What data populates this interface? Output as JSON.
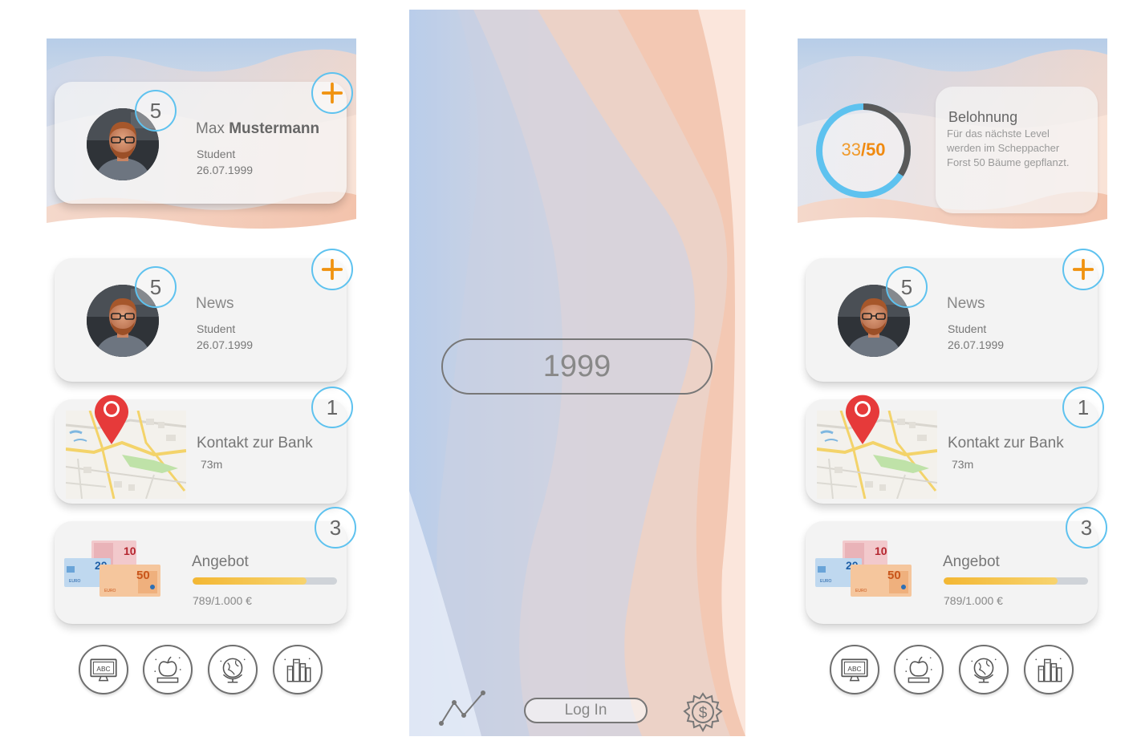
{
  "profile": {
    "first_name": "Max",
    "last_name": "Mustermann",
    "role": "Student",
    "birthdate": "26.07.1999",
    "badge_count": "5"
  },
  "news": {
    "title": "News",
    "role": "Student",
    "date": "26.07.1999",
    "badge_count": "5"
  },
  "bank": {
    "title": "Kontakt zur Bank",
    "distance": "73m",
    "badge_count": "1"
  },
  "offer": {
    "title": "Angebot",
    "amount_text": "789/1.000 €",
    "progress_current": 789,
    "progress_total": 1000,
    "badge_count": "3",
    "banknotes": [
      "10",
      "20",
      "50"
    ]
  },
  "login": {
    "year_value": "1999",
    "login_label": "Log In"
  },
  "reward": {
    "title": "Belohnung",
    "text": "Für das nächste Level werden im Scheppacher Forst 50 Bäume gepflanzt.",
    "current": "33",
    "separator": "/",
    "total": "50",
    "progress_fraction": 0.66
  },
  "bottom_nav": [
    {
      "icon": "abc-monitor-icon"
    },
    {
      "icon": "apple-book-icon"
    },
    {
      "icon": "globe-icon"
    },
    {
      "icon": "books-icon"
    }
  ],
  "colors": {
    "accent_blue": "#5ec2ef",
    "accent_orange": "#f0920f",
    "progress_fill": "#f3b733",
    "pin_red": "#e63a3a"
  }
}
